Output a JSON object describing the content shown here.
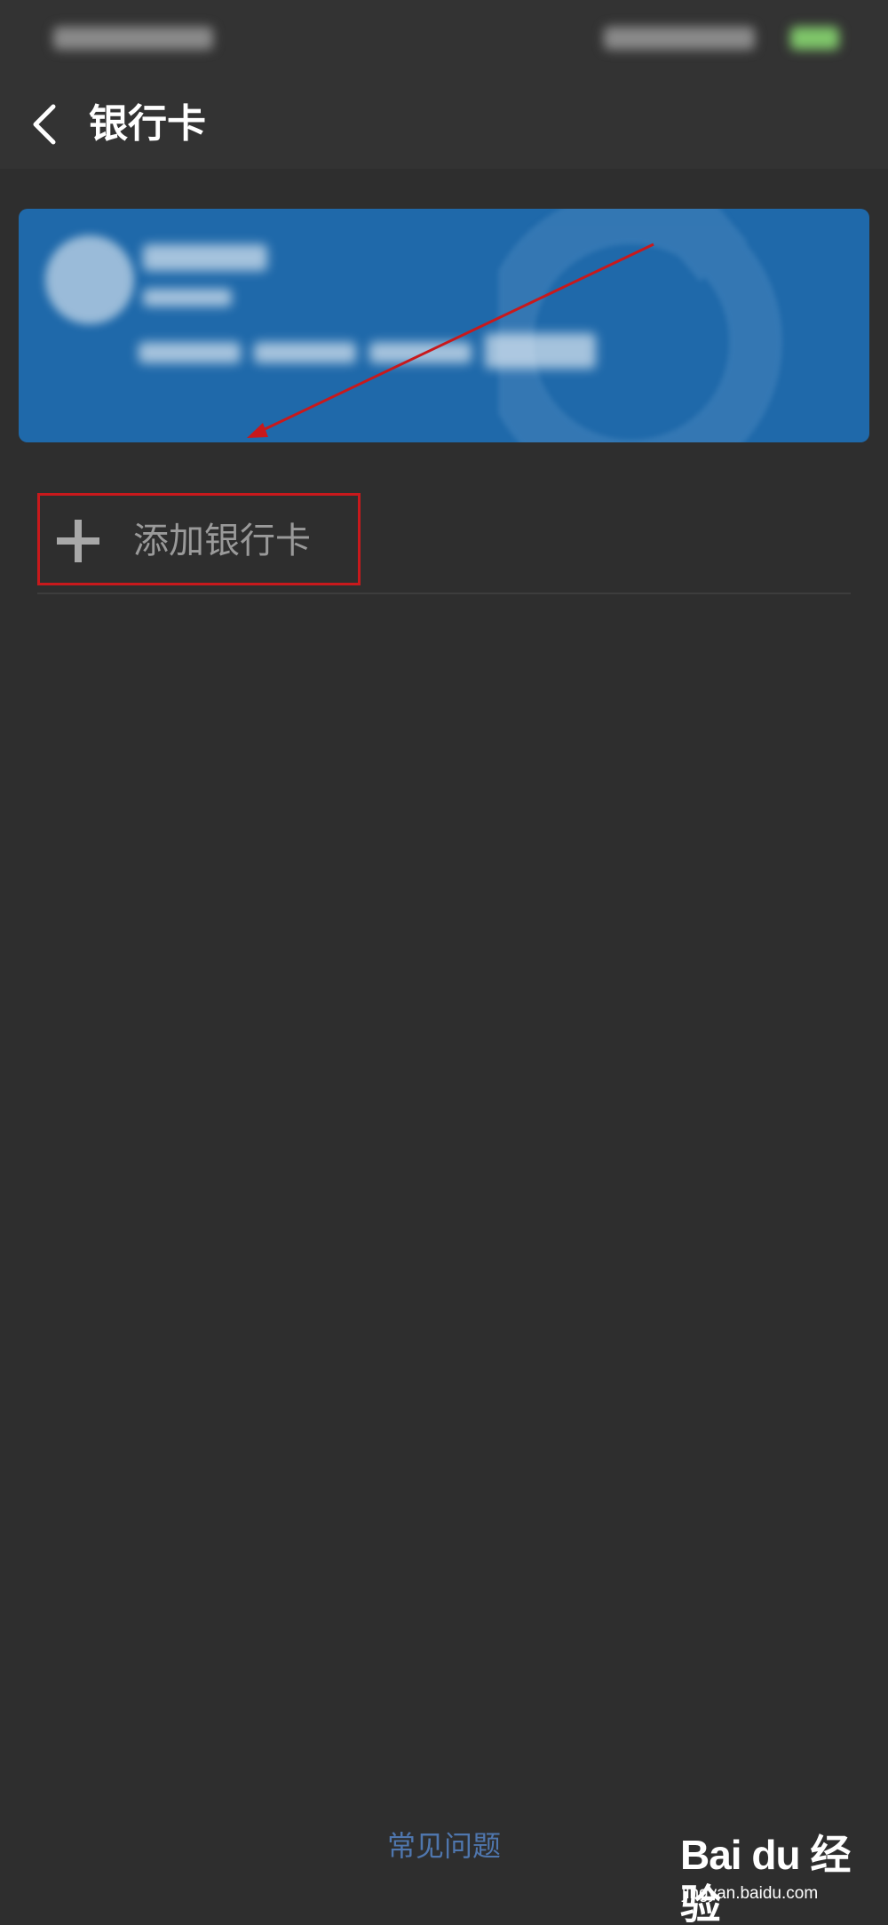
{
  "header": {
    "title": "银行卡",
    "back_icon": "chevron-left-icon"
  },
  "card": {
    "color": "#1f69aa"
  },
  "add_card": {
    "label": "添加银行卡",
    "icon": "plus-icon",
    "highlight_color": "#c8191c"
  },
  "footer": {
    "faq_label": "常见问题",
    "faq_color": "#4f76ad"
  },
  "watermark": {
    "brand": "Bai du 经验",
    "url": "jingyan.baidu.com"
  }
}
